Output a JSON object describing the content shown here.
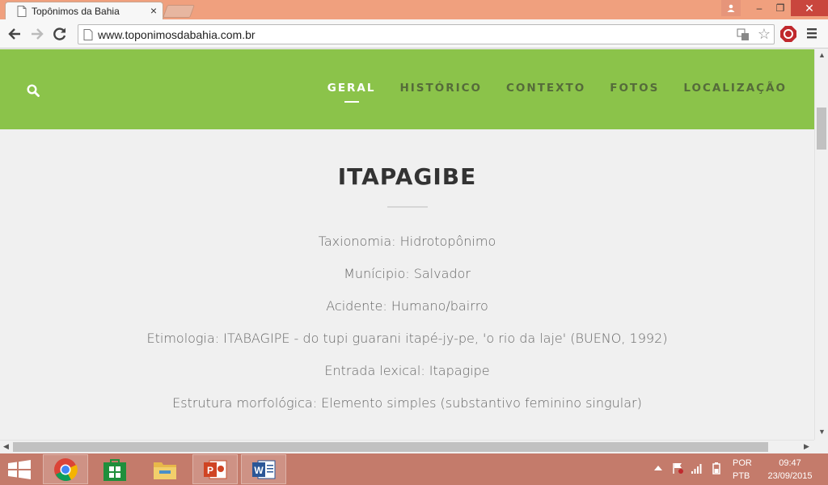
{
  "browser": {
    "tab_title": "Topônimos da Bahia",
    "tab_close": "×",
    "url": "www.toponimosdabahia.com.br",
    "star": "☆",
    "window_close": "✕",
    "window_minimize": "–",
    "window_restore": "❐"
  },
  "site": {
    "nav": [
      {
        "label": "GERAL",
        "active": true
      },
      {
        "label": "HISTÓRICO",
        "active": false
      },
      {
        "label": "CONTEXTO",
        "active": false
      },
      {
        "label": "FOTOS",
        "active": false
      },
      {
        "label": "LOCALIZAÇÃO",
        "active": false
      }
    ],
    "header_color": "#8bc34a"
  },
  "content": {
    "title": "ITAPAGIBE",
    "lines": [
      "Taxionomia: Hidrotopônimo",
      "Munícipio: Salvador",
      "Acidente: Humano/bairro",
      "Etimologia: ITABAGIPE - do tupi guarani itapé-jy-pe, 'o rio da laje' (BUENO, 1992)",
      "Entrada lexical: Itapagipe",
      "Estrutura morfológica: Elemento simples (substantivo feminino singular)"
    ]
  },
  "taskbar": {
    "language": [
      "POR",
      "PTB"
    ],
    "time": "09:47",
    "date": "23/09/2015",
    "apps": [
      "chrome-icon",
      "store-icon",
      "file-explorer-icon",
      "powerpoint-icon",
      "word-icon"
    ]
  }
}
